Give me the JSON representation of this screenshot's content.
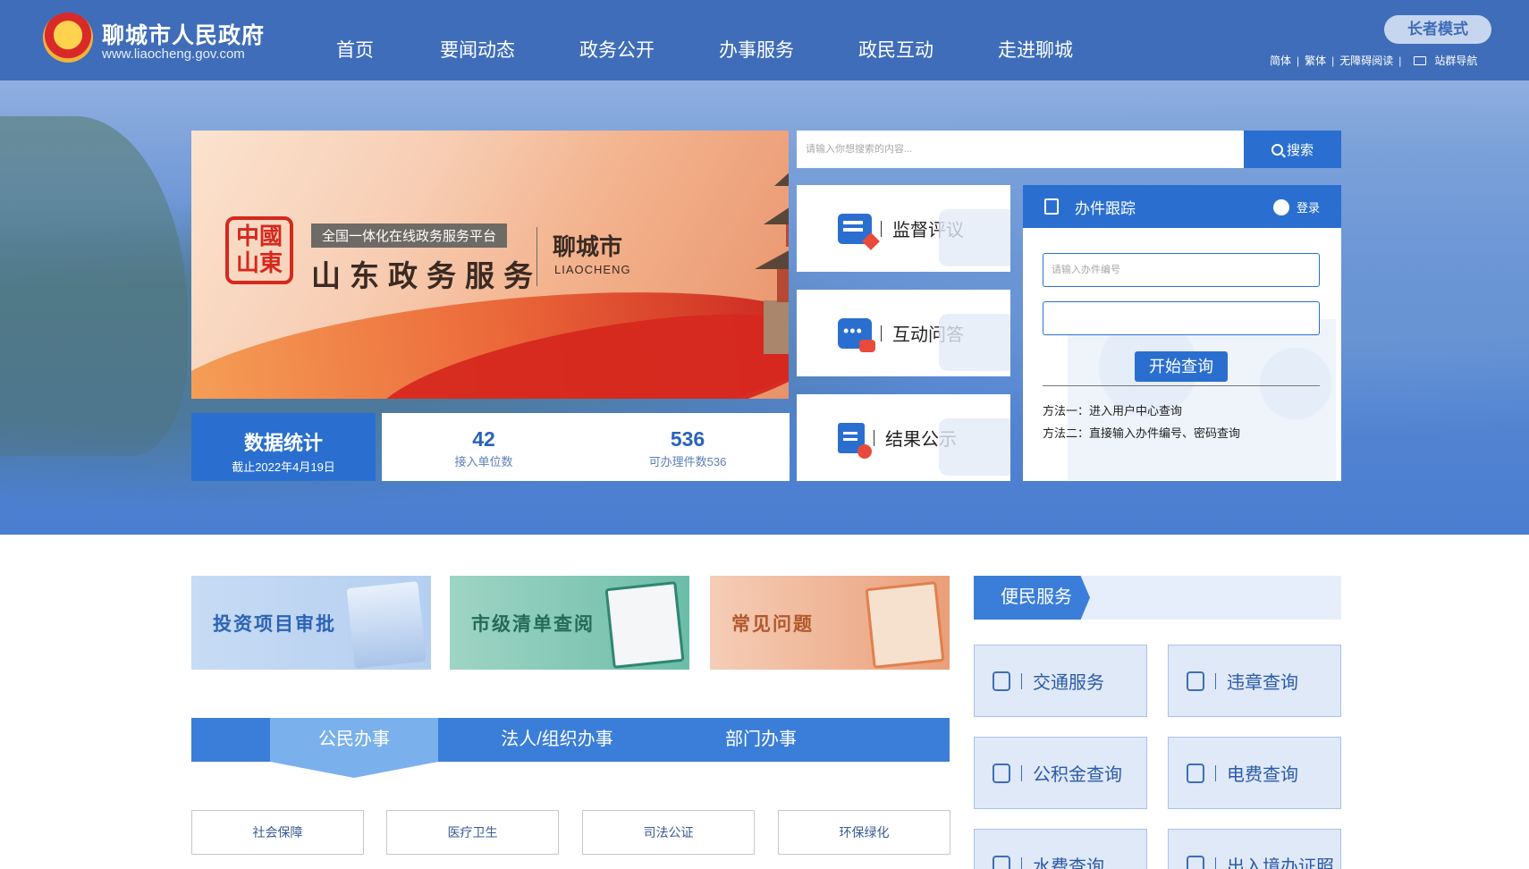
{
  "header": {
    "site_title": "聊城市人民政府",
    "site_url": "www.liaocheng.gov.com",
    "nav": [
      "首页",
      "要闻动态",
      "政务公开",
      "办事服务",
      "政民互动",
      "走进聊城"
    ],
    "elder_mode": "长者模式",
    "links": {
      "simplified": "简体",
      "traditional": "繁体",
      "accessible": "无障碍阅读",
      "sitemap": "站群导航"
    }
  },
  "banner": {
    "seal_text": "中國山東",
    "subtitle": "全国一体化在线政务服务平台",
    "title": "山东政务服务",
    "city": "聊城市",
    "city_pinyin": "LIAOCHENG"
  },
  "stats": {
    "label": "数据统计",
    "date": "截止2022年4月19日",
    "items": [
      {
        "value": "42",
        "label": "接入单位数"
      },
      {
        "value": "536",
        "label": "可办理件数536"
      }
    ]
  },
  "search": {
    "placeholder": "请输入你想搜索的内容...",
    "button": "搜索"
  },
  "services": [
    "监督评议",
    "互动问答",
    "结果公示"
  ],
  "tracking": {
    "title": "办件跟踪",
    "login": "登录",
    "number_placeholder": "请输入办件编号",
    "password_placeholder": "",
    "button": "开始查询",
    "method1": "方法一：进入用户中心查询",
    "method2": "方法二：直接输入办件编号、密码查询"
  },
  "quick_links": [
    "投资项目审批",
    "市级清单查阅",
    "常见问题"
  ],
  "tabs": [
    "公民办事",
    "法人/组织办事",
    "部门办事"
  ],
  "sub_tabs": [
    "社会保障",
    "医疗卫生",
    "司法公证",
    "环保绿化"
  ],
  "convenience": {
    "title": "便民服务",
    "items": [
      "交通服务",
      "违章查询",
      "公积金查询",
      "电费查询",
      "水费查询",
      "出入境办证照"
    ]
  }
}
